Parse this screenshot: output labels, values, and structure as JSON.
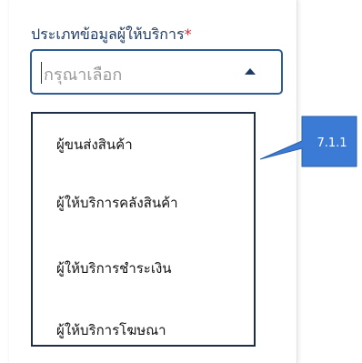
{
  "field": {
    "label": "ประเภทข้อมูลผู้ให้บริการ",
    "required_mark": "*",
    "placeholder": "กรุณาเลือก"
  },
  "dropdown": {
    "options": [
      "ผู้ขนส่งสินค้า",
      "ผู้ให้บริการคลังสินค้า",
      "ผู้ให้บริการชำระเงิน",
      "ผู้ให้บริการโฆษณา"
    ]
  },
  "callout": {
    "text": "7.1.1",
    "color": "#3b7bd6"
  },
  "colors": {
    "label": "#1f3b63",
    "required": "#e0242f",
    "select_border": "#2c5d95",
    "dropdown_border": "#1d2e45"
  }
}
